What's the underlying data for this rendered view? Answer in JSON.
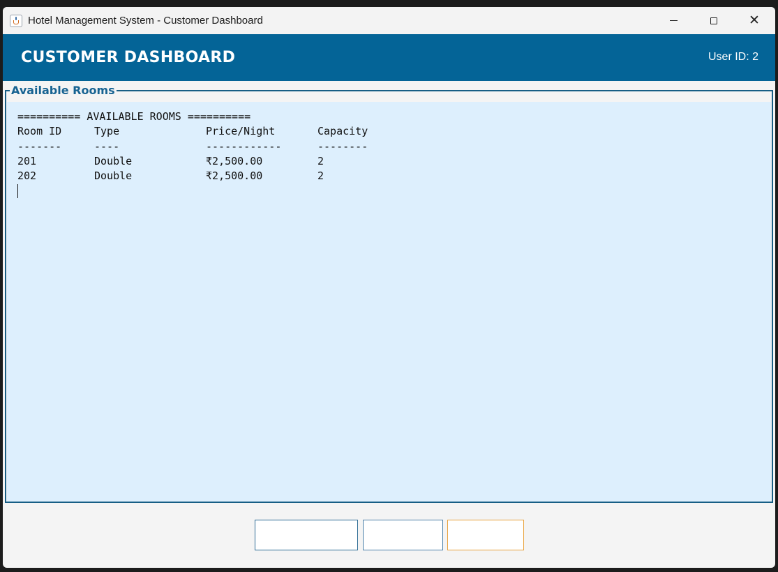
{
  "window": {
    "title": "Hotel Management System - Customer Dashboard",
    "controls": [
      "minimize",
      "maximize",
      "close"
    ]
  },
  "header": {
    "title": "CUSTOMER DASHBOARD",
    "user_label": "User ID: 2"
  },
  "panel": {
    "title": "Available Rooms",
    "banner": "========== AVAILABLE ROOMS ==========",
    "columns": [
      "Room ID",
      "Type",
      "Price/Night",
      "Capacity"
    ],
    "separators": [
      "-------",
      "----",
      "------------",
      "--------"
    ],
    "rows": [
      [
        "201",
        "Double",
        "₹2,500.00",
        "2"
      ],
      [
        "202",
        "Double",
        "₹2,500.00",
        "2"
      ]
    ]
  },
  "buttons": [
    {
      "label": "",
      "border_color": "#2b6a93"
    },
    {
      "label": "",
      "border_color": "#4a7fa8"
    },
    {
      "label": "",
      "border_color": "#e8a13a"
    }
  ],
  "colors": {
    "header_bg": "#046497",
    "panel_border": "#175e85",
    "legend_text": "#176392",
    "textarea_bg": "#ddeffd"
  }
}
